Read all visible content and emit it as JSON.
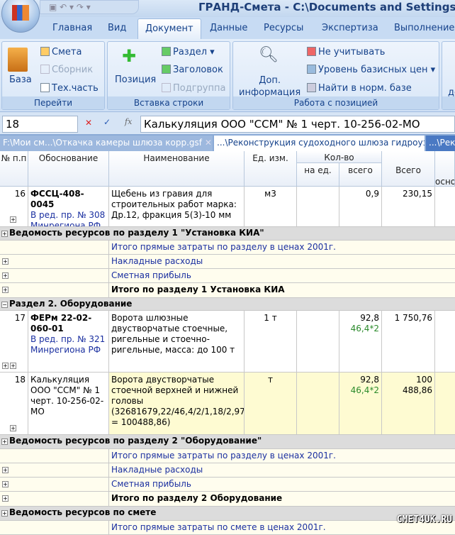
{
  "app": {
    "title": "ГРАНД-Смета - C:\\Documents and Settings\\o."
  },
  "ribbon_tabs": [
    "Главная",
    "Вид",
    "Документ",
    "Данные",
    "Ресурсы",
    "Экспертиза",
    "Выполнение"
  ],
  "groups": {
    "go": {
      "label": "Перейти",
      "baza": "База",
      "smeta": "Смета",
      "sbornik": "Сборник",
      "tech": "Тех.часть"
    },
    "insert": {
      "label": "Вставка строки",
      "pos": "Позиция",
      "razdel": "Раздел",
      "zag": "Заголовок",
      "podgr": "Подгруппа"
    },
    "work": {
      "label": "Работа с позицией",
      "dop": "Доп.",
      "info": "информация",
      "neuch": "Не учитывать",
      "uroven": "Уровень базисных цен",
      "najti": "Найти в норм. базе"
    },
    "more": {
      "cut": "до"
    }
  },
  "formula": {
    "cell": "18",
    "value": "Калькуляция ООО \"ССМ\" № 1 черт. 10-256-02-МО"
  },
  "doc_tabs": [
    "F:\\Мои см...\\Откачка камеры шлюза корр.gsf",
    "...\\Реконструкция судоходного шлюза гидроуз",
    "...\\Рек"
  ],
  "headers": {
    "num": "№ п.п",
    "obosn": "Обоснование",
    "name": "Наименование",
    "unit": "Ед. изм.",
    "qty": "Кол-во",
    "per": "на ед.",
    "total": "всего",
    "sum": "Всего",
    "osn": "осно"
  },
  "rows": {
    "r16": {
      "num": "16",
      "code": "ФССЦ-408-0045",
      "note1": "В ред. пр. № 308",
      "note2": "Минрегиона РФ",
      "name": "Щебень из гравия для строительных работ марка: Др.12, фракция 5(3)-10 мм",
      "unit": "м3",
      "total": "0,9",
      "sum": "230,15"
    },
    "r17": {
      "num": "17",
      "code": "ФЕРм 22-02-060-01",
      "note1": "В ред. пр. № 321",
      "note2": "Минрегиона РФ",
      "name": "Ворота шлюзные двустворчатые стоечные, ригельные и стоечно-ригельные, масса: до 100 т",
      "unit": "1 т",
      "total": "92,8",
      "formula": "46,4*2",
      "sum": "1 750,76"
    },
    "r18": {
      "num": "18",
      "code": "Калькуляция ООО \"ССМ\" № 1 черт. 10-256-02-МО",
      "name": "Ворота двустворчатые стоечной верхней и нижней головы (32681679,22/46,4/2/1,18/2,97 = 100488,86)",
      "unit": "т",
      "total": "92,8",
      "formula": "46,4*2",
      "sum": "100 488,86"
    }
  },
  "sections": {
    "ved1": "Ведомость ресурсов по разделу 1 \"Установка КИА\"",
    "itogo_pr1": "Итого прямые затраты по разделу в ценах 2001г.",
    "nakl": "Накладные расходы",
    "prib": "Сметная прибыль",
    "itogo1": "Итого по разделу 1 Установка КИА",
    "razdel2": "Раздел 2. Оборудование",
    "ved2": "Ведомость ресурсов по разделу 2 \"Оборудование\"",
    "itogo2": "Итого по разделу 2 Оборудование",
    "vedsm": "Ведомость ресурсов по смете",
    "itogo_sm": "Итого прямые затраты по смете в ценах 2001г."
  },
  "watermark": "CMET4UK.RU"
}
